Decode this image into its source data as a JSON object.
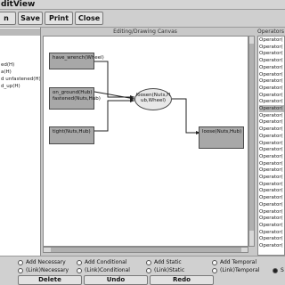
{
  "menu": [
    "dit",
    "View"
  ],
  "toolbar": {
    "buttons": [
      "n",
      "Save",
      "Print",
      "Close"
    ]
  },
  "left_panel": {
    "items": [
      "ed(H)",
      "a(H)",
      "d unfastened(H)",
      "d_up(H)"
    ]
  },
  "canvas": {
    "title": "Editing/Drawing Canvas",
    "nodes": {
      "have_wrench": "have_wrench(Wheel)",
      "on_ground": "on_ground(Hub)\nfastened(Nuts,Hub)",
      "tight": "tight(Nuts,Hub)",
      "loosen": "loosen(Nuts,H\nub,Wheel)",
      "loose": "loose(Nuts,Hub)"
    }
  },
  "right_panel": {
    "title": "Operators",
    "items": [
      "Operator(",
      "Operator(",
      "Operator(",
      "Operator(",
      "Operator(",
      "Operator(",
      "Operator(",
      "Operator(",
      "Operator(",
      "Operator(",
      "Operator(",
      "Operator(",
      "Operator(",
      "Operator(",
      "Operator(",
      "Operator(",
      "Operator(",
      "Operator(",
      "Operator(",
      "Operator(",
      "Operator(",
      "Operator(",
      "Operator(",
      "Operator(",
      "Operator(",
      "Operator(",
      "Operator(",
      "Operator(",
      "Operator(",
      "Operator(",
      "Operator("
    ],
    "selected_index": 10
  },
  "bottom": {
    "radios_row1": [
      "Add Necessary",
      "Add Conditional",
      "Add Static",
      "Add Temporal"
    ],
    "radios_row2": [
      "(Link)Necessary",
      "(Link)Conditional",
      "(Link)Static",
      "(Link)Temporal"
    ],
    "last_radio": "S",
    "buttons": [
      "Delete",
      "Undo",
      "Redo"
    ]
  }
}
